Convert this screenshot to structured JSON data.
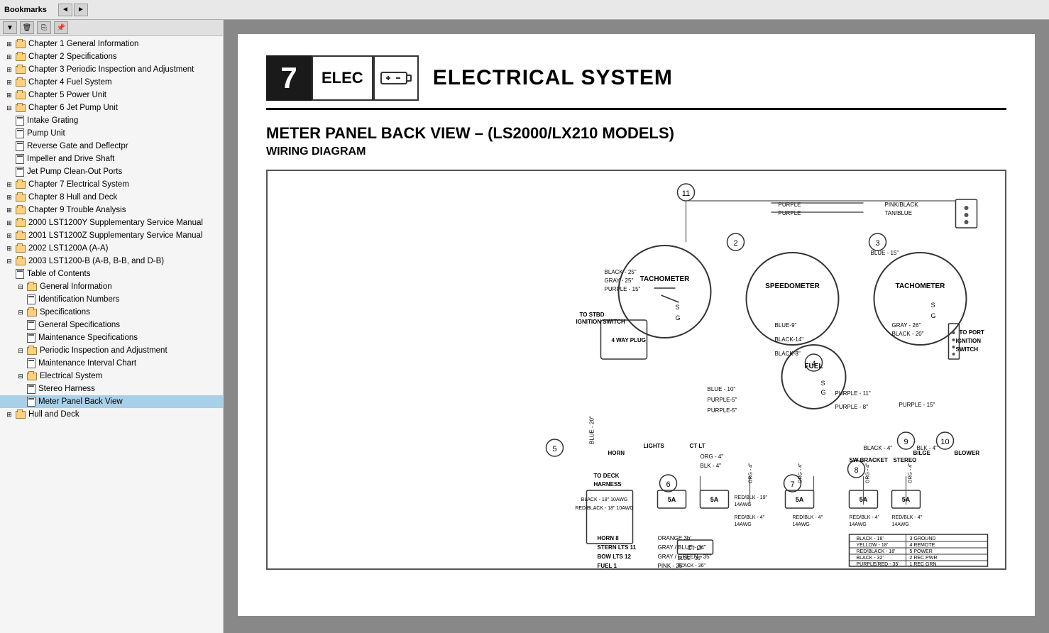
{
  "toolbar": {
    "title": "Bookmarks",
    "nav_prev": "◄",
    "nav_next": "►",
    "delete_btn": "🗑",
    "copy_btn": "📋",
    "paste_btn": "📌",
    "dropdown_btn": "▼"
  },
  "sidebar": {
    "items": [
      {
        "id": "ch1",
        "label": "Chapter 1 General Information",
        "level": 1,
        "type": "folder",
        "expanded": false
      },
      {
        "id": "ch2",
        "label": "Chapter 2 Specifications",
        "level": 1,
        "type": "folder",
        "expanded": false
      },
      {
        "id": "ch3",
        "label": "Chapter 3 Periodic Inspection and Adjustment",
        "level": 1,
        "type": "folder",
        "expanded": false
      },
      {
        "id": "ch4",
        "label": "Chapter 4 Fuel System",
        "level": 1,
        "type": "folder",
        "expanded": false
      },
      {
        "id": "ch5",
        "label": "Chapter 5 Power Unit",
        "level": 1,
        "type": "folder",
        "expanded": false
      },
      {
        "id": "ch6",
        "label": "Chapter 6 Jet Pump Unit",
        "level": 1,
        "type": "folder",
        "expanded": true
      },
      {
        "id": "ch6-1",
        "label": "Intake Grating",
        "level": 2,
        "type": "page"
      },
      {
        "id": "ch6-2",
        "label": "Pump Unit",
        "level": 2,
        "type": "page"
      },
      {
        "id": "ch6-3",
        "label": "Reverse Gate and Deflectpr",
        "level": 2,
        "type": "page"
      },
      {
        "id": "ch6-4",
        "label": "Impeller and Drive Shaft",
        "level": 2,
        "type": "page"
      },
      {
        "id": "ch6-5",
        "label": "Jet Pump Clean-Out Ports",
        "level": 2,
        "type": "page"
      },
      {
        "id": "ch7",
        "label": "Chapter 7 Electrical System",
        "level": 1,
        "type": "folder",
        "expanded": false
      },
      {
        "id": "ch8",
        "label": "Chapter 8 Hull and Deck",
        "level": 1,
        "type": "folder",
        "expanded": false
      },
      {
        "id": "ch9",
        "label": "Chapter 9 Trouble Analysis",
        "level": 1,
        "type": "folder",
        "expanded": false
      },
      {
        "id": "supp2000",
        "label": "2000 LST1200Y Supplementary Service Manual",
        "level": 1,
        "type": "folder",
        "expanded": false
      },
      {
        "id": "supp2001",
        "label": "2001 LST1200Z Supplementary Service Manual",
        "level": 1,
        "type": "folder",
        "expanded": false
      },
      {
        "id": "lst2002",
        "label": "2002 LST1200A (A-A)",
        "level": 1,
        "type": "folder",
        "expanded": false
      },
      {
        "id": "lst2003",
        "label": "2003 LST1200-B (A-B, B-B, and D-B)",
        "level": 1,
        "type": "folder",
        "expanded": true
      },
      {
        "id": "toc",
        "label": "Table of Contents",
        "level": 2,
        "type": "page"
      },
      {
        "id": "geninfo",
        "label": "General Information",
        "level": 2,
        "type": "folder",
        "expanded": true
      },
      {
        "id": "idnums",
        "label": "Identification Numbers",
        "level": 3,
        "type": "page"
      },
      {
        "id": "specs",
        "label": "Specifications",
        "level": 2,
        "type": "folder",
        "expanded": true
      },
      {
        "id": "genspecs",
        "label": "General Specifications",
        "level": 3,
        "type": "page"
      },
      {
        "id": "maintspecs",
        "label": "Maintenance Specifications",
        "level": 3,
        "type": "page"
      },
      {
        "id": "periodic",
        "label": "Periodic Inspection and Adjustment",
        "level": 2,
        "type": "folder",
        "expanded": true
      },
      {
        "id": "maintchart",
        "label": "Maintenance Interval Chart",
        "level": 3,
        "type": "page"
      },
      {
        "id": "elec",
        "label": "Electrical System",
        "level": 2,
        "type": "folder",
        "expanded": true
      },
      {
        "id": "stereo",
        "label": "Stereo Harness",
        "level": 3,
        "type": "page"
      },
      {
        "id": "meter",
        "label": "Meter Panel Back View",
        "level": 3,
        "type": "page",
        "selected": true
      },
      {
        "id": "hulldeck",
        "label": "Hull and Deck",
        "level": 1,
        "type": "folder",
        "expanded": false
      }
    ]
  },
  "content": {
    "chapter_number": "7",
    "chapter_code": "ELEC",
    "chapter_title": "ELECTRICAL SYSTEM",
    "section_title": "METER PANEL BACK VIEW – (LS2000/LX210 MODELS)",
    "section_subtitle": "WIRING DIAGRAM"
  },
  "legend": {
    "rows": [
      {
        "wire": "BLACK - 18'",
        "code": "3 GROUND"
      },
      {
        "wire": "YELLOW - 18'",
        "code": "4 REMOTE"
      },
      {
        "wire": "RED/BLACK - 18'",
        "code": "5 POWER"
      },
      {
        "wire": "BLACK - 32'",
        "code": "2 REC PWR"
      },
      {
        "wire": "PURPLE/RED - 35'",
        "code": "1 REC GRN"
      }
    ]
  }
}
